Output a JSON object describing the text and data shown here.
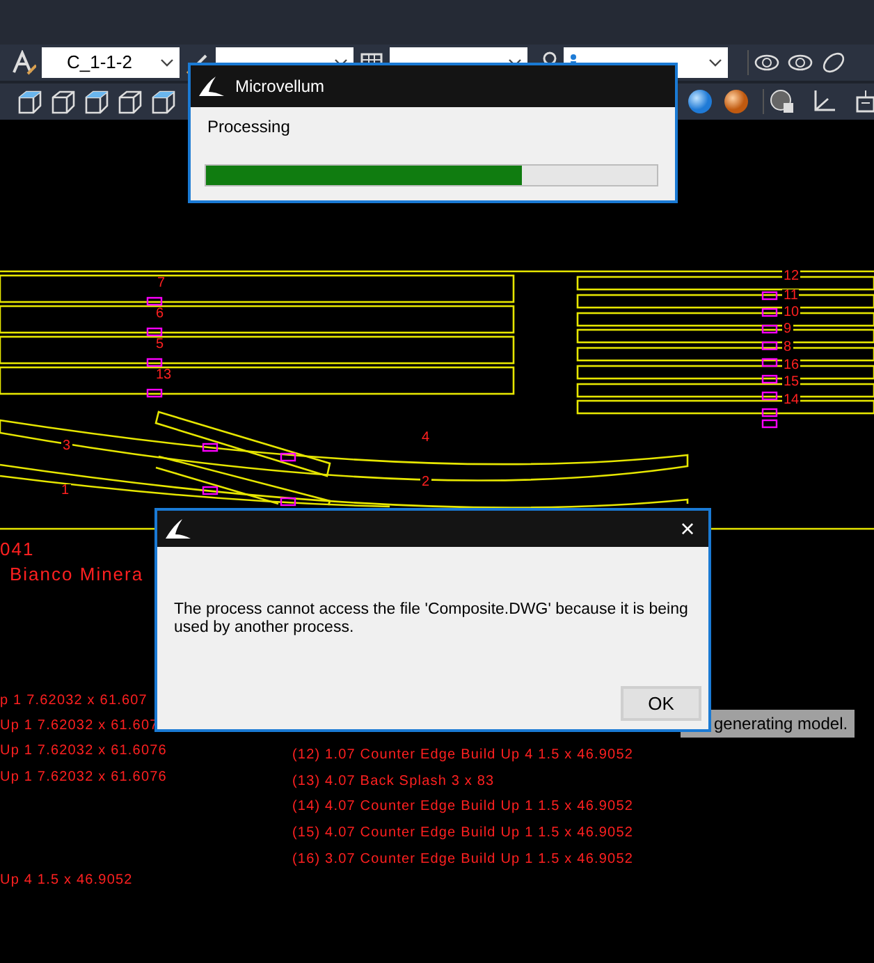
{
  "toolbar": {
    "dropdowns": [
      {
        "value": "C_1-1-2",
        "kind": "plain"
      },
      {
        "kind": "plain"
      },
      {
        "kind": "plain"
      },
      {
        "kind": "annotative"
      }
    ]
  },
  "drawing": {
    "part_numbers": [
      "7",
      "6",
      "5",
      "13",
      "12",
      "11",
      "10",
      "9",
      "8",
      "16",
      "15",
      "14",
      "3",
      "4",
      "1",
      "2"
    ],
    "headings": [
      "041",
      "Bianco Minera"
    ],
    "left_list": [
      "p 1 7.62032 x 61.607",
      "Up 1 7.62032 x 61.607",
      "Up 1 7.62032 x 61.6076",
      "Up 1 7.62032 x 61.6076",
      "Up 4 1.5 x 46.9052"
    ],
    "right_list": [
      "(12) 1.07 Counter Edge Build Up 4 1.5 x 46.9052",
      "(13) 4.07 Back Splash 3 x 83",
      "(14) 4.07 Counter Edge Build Up 1 1.5 x 46.9052",
      "(15) 4.07 Counter Edge Build Up 1 1.5 x 46.9052",
      "(16) 3.07 Counter Edge Build Up 1 1.5 x 46.9052"
    ]
  },
  "status": "generating model.",
  "processing_dialog": {
    "title": "Microvellum",
    "message": "Processing",
    "level": 0.7
  },
  "error_dialog": {
    "close": "×",
    "message": "The process cannot access the file 'Composite.DWG' because it is being used by another process.",
    "button": "OK"
  }
}
